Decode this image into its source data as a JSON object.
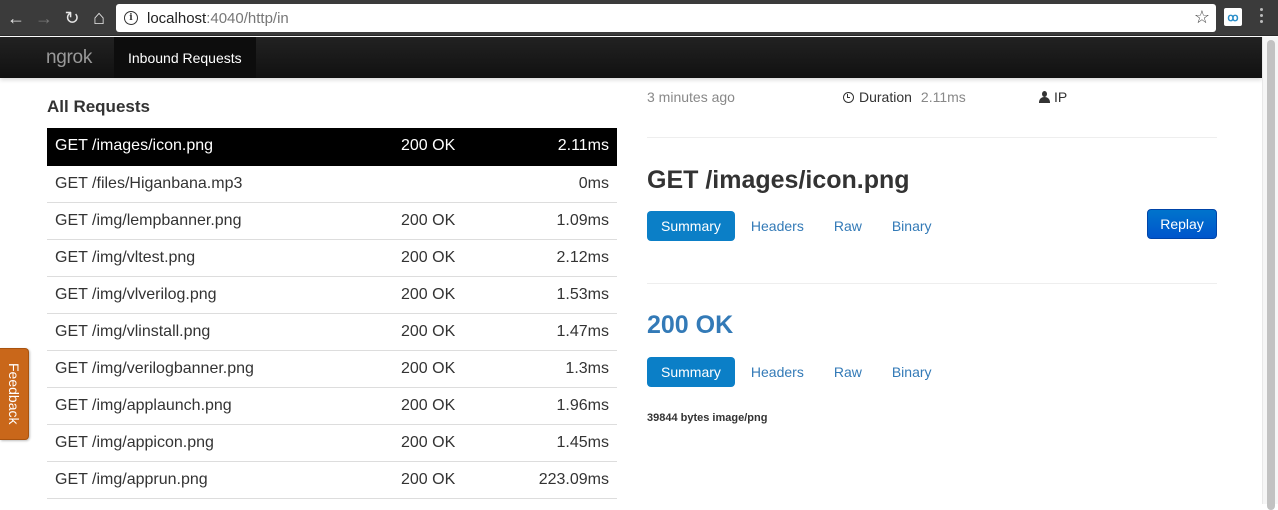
{
  "browser": {
    "url_host": "localhost",
    "url_rest": ":4040/http/in",
    "back_icon": "arrow-left-icon",
    "forward_icon": "arrow-right-icon",
    "reload_icon": "reload-icon",
    "home_icon": "home-icon",
    "info_icon": "info-icon",
    "bookmark_icon": "star-icon",
    "info_glyph": "i",
    "back_glyph": "←",
    "forward_glyph": "→",
    "reload_glyph": "↻",
    "home_glyph": "⌂",
    "star_glyph": "☆",
    "ext_glyph": "ꝏ"
  },
  "navbar": {
    "brand": "ngrok",
    "tab": "Inbound Requests"
  },
  "requests": {
    "title": "All Requests",
    "selected_index": 0,
    "rows": [
      {
        "path": "GET /images/icon.png",
        "status": "200 OK",
        "duration": "2.11ms"
      },
      {
        "path": "GET /files/Higanbana.mp3",
        "status": "",
        "duration": "0ms"
      },
      {
        "path": "GET /img/lempbanner.png",
        "status": "200 OK",
        "duration": "1.09ms"
      },
      {
        "path": "GET /img/vltest.png",
        "status": "200 OK",
        "duration": "2.12ms"
      },
      {
        "path": "GET /img/vlverilog.png",
        "status": "200 OK",
        "duration": "1.53ms"
      },
      {
        "path": "GET /img/vlinstall.png",
        "status": "200 OK",
        "duration": "1.47ms"
      },
      {
        "path": "GET /img/verilogbanner.png",
        "status": "200 OK",
        "duration": "1.3ms"
      },
      {
        "path": "GET /img/applaunch.png",
        "status": "200 OK",
        "duration": "1.96ms"
      },
      {
        "path": "GET /img/appicon.png",
        "status": "200 OK",
        "duration": "1.45ms"
      },
      {
        "path": "GET /img/apprun.png",
        "status": "200 OK",
        "duration": "223.09ms"
      }
    ]
  },
  "feedback": {
    "label": "Feedback",
    "color": "#c9671a"
  },
  "detail": {
    "time_ago": "3 minutes ago",
    "duration_label": "Duration",
    "duration_value": "2.11ms",
    "ip_label": "IP",
    "request_title": "GET /images/icon.png",
    "request_tabs": [
      "Summary",
      "Headers",
      "Raw",
      "Binary"
    ],
    "request_active_tab": "Summary",
    "replay_label": "Replay",
    "response_title": "200 OK",
    "response_tabs": [
      "Summary",
      "Headers",
      "Raw",
      "Binary"
    ],
    "response_active_tab": "Summary",
    "response_body_info": "39844 bytes image/png",
    "accent_color": "#0b7fc7",
    "status_color": "#337ab7"
  }
}
